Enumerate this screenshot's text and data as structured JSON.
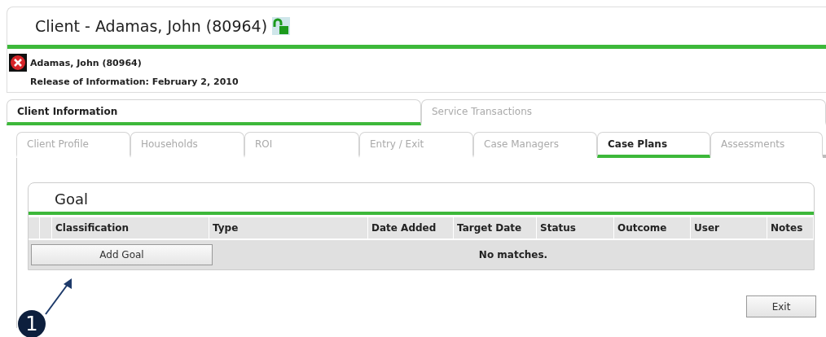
{
  "header": {
    "title": "Client - Adamas, John (80964)"
  },
  "client": {
    "name": "Adamas, John (80964)",
    "release": "Release of Information: February 2, 2010"
  },
  "main_tabs": [
    {
      "label": "Client Information",
      "selected": true
    },
    {
      "label": "Service Transactions",
      "selected": false
    }
  ],
  "sub_tabs": [
    {
      "label": "Client Profile",
      "selected": false
    },
    {
      "label": "Households",
      "selected": false
    },
    {
      "label": "ROI",
      "selected": false
    },
    {
      "label": "Entry / Exit",
      "selected": false
    },
    {
      "label": "Case Managers",
      "selected": false
    },
    {
      "label": "Case Plans",
      "selected": true
    },
    {
      "label": "Assessments",
      "selected": false
    }
  ],
  "goal_panel": {
    "title": "Goal",
    "columns": [
      "Classification",
      "Type",
      "Date Added",
      "Target Date",
      "Status",
      "Outcome",
      "User",
      "Notes"
    ],
    "add_button": "Add Goal",
    "empty_message": "No matches."
  },
  "annotation": {
    "number": "1"
  },
  "exit_button": "Exit"
}
